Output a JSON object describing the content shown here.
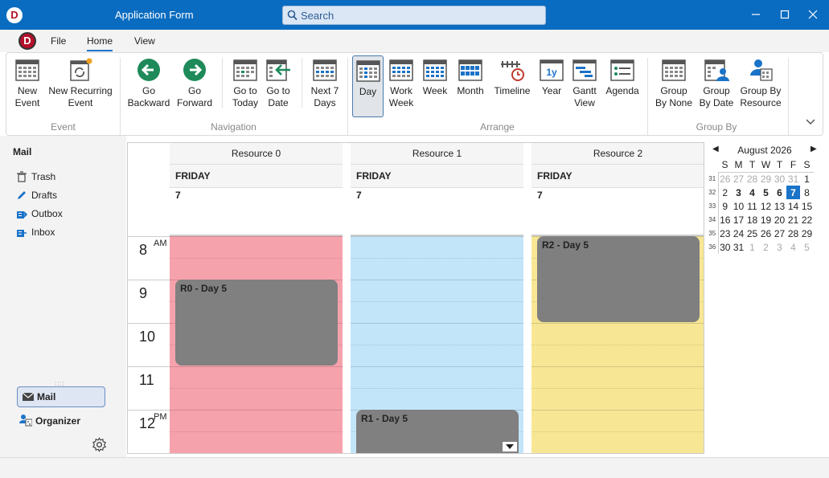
{
  "window": {
    "title": "Application Form"
  },
  "search": {
    "placeholder": "Search"
  },
  "menu": {
    "file": "File",
    "home": "Home",
    "view": "View"
  },
  "ribbon": {
    "new_event": "New\nEvent",
    "new_recurring": "New Recurring\nEvent",
    "go_backward": "Go\nBackward",
    "go_forward": "Go\nForward",
    "go_today": "Go to\nToday",
    "go_date": "Go to\nDate",
    "next7": "Next 7\nDays",
    "day": "Day",
    "work_week": "Work\nWeek",
    "week": "Week",
    "month": "Month",
    "timeline": "Timeline",
    "year": "Year",
    "gantt": "Gantt\nView",
    "agenda": "Agenda",
    "group_none": "Group\nBy None",
    "group_date": "Group\nBy Date",
    "group_resource": "Group By\nResource",
    "groups": {
      "event": "Event",
      "navigation": "Navigation",
      "arrange": "Arrange",
      "group_by": "Group By"
    }
  },
  "sidebar": {
    "header": "Mail",
    "folders": [
      "Trash",
      "Drafts",
      "Outbox",
      "Inbox"
    ],
    "nav_mail": "Mail",
    "nav_organizer": "Organizer"
  },
  "calendar": {
    "resources": [
      {
        "name": "Resource 0",
        "day": "FRIDAY",
        "date": "7",
        "color": "#f6a2ad",
        "appt": "R0 - Day 5"
      },
      {
        "name": "Resource 1",
        "day": "FRIDAY",
        "date": "7",
        "color": "#c3e5fa",
        "appt": "R1 - Day 5"
      },
      {
        "name": "Resource 2",
        "day": "FRIDAY",
        "date": "7",
        "color": "#f7e795",
        "appt": "R2 - Day 5"
      }
    ],
    "hours": [
      {
        "num": "8",
        "ampm": "AM"
      },
      {
        "num": "9",
        "ampm": ""
      },
      {
        "num": "10",
        "ampm": ""
      },
      {
        "num": "11",
        "ampm": ""
      },
      {
        "num": "12",
        "ampm": "PM"
      }
    ]
  },
  "minical": {
    "title": "August 2026",
    "weekdays": [
      "S",
      "M",
      "T",
      "W",
      "T",
      "F",
      "S"
    ],
    "weeks": [
      {
        "wk": "31",
        "days": [
          "26",
          "27",
          "28",
          "29",
          "30",
          "31",
          "1"
        ]
      },
      {
        "wk": "32",
        "days": [
          "2",
          "3",
          "4",
          "5",
          "6",
          "7",
          "8"
        ]
      },
      {
        "wk": "33",
        "days": [
          "9",
          "10",
          "11",
          "12",
          "13",
          "14",
          "15"
        ]
      },
      {
        "wk": "34",
        "days": [
          "16",
          "17",
          "18",
          "19",
          "20",
          "21",
          "22"
        ]
      },
      {
        "wk": "35",
        "days": [
          "23",
          "24",
          "25",
          "26",
          "27",
          "28",
          "29"
        ]
      },
      {
        "wk": "36",
        "days": [
          "30",
          "31",
          "1",
          "2",
          "3",
          "4",
          "5"
        ]
      }
    ],
    "selected": "7"
  },
  "colors": {
    "titlebar": "#0a6cc0",
    "accent": "#1a73c8"
  }
}
